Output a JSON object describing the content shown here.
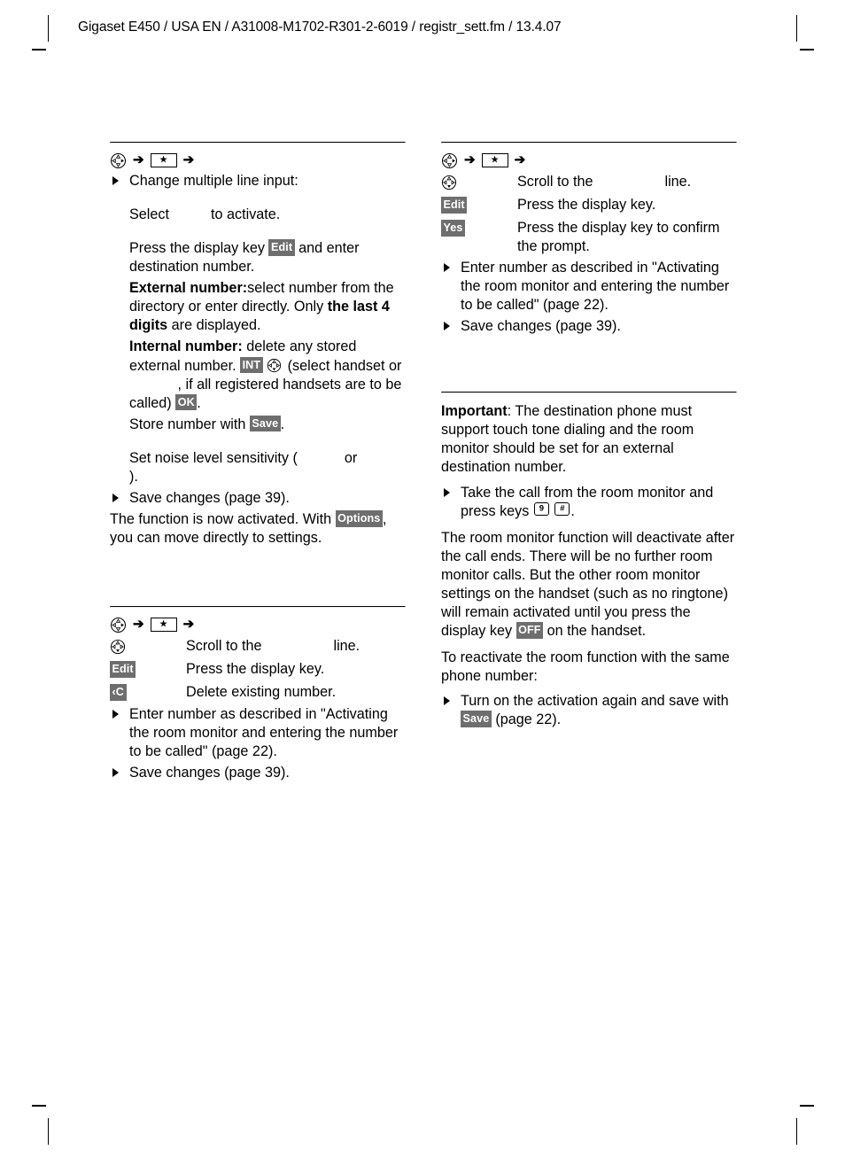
{
  "header": {
    "text": "Gigaset E450 / USA EN / A31008-M1702-R301-2-6019 / registr_sett.fm / 13.4.07"
  },
  "icons": {
    "nav": "navigation-key-icon",
    "arrow": "➔",
    "star_key": "star-key-icon",
    "key_9": "9",
    "key_hash": "#"
  },
  "softkeys": {
    "edit": "Edit",
    "save": "Save",
    "ok": "OK",
    "yes": "Yes",
    "off": "OFF",
    "int": "INT",
    "options": "Options",
    "delete": "‹C"
  },
  "left_column": {
    "section1": {
      "bullet1": "Change multiple line input:",
      "line_select_pre": "Select",
      "line_select_post": "to activate.",
      "press_key_pre": "Press the display key",
      "press_key_post": "and enter destination number.",
      "external_label": "External number:",
      "external_text_1": "select number from the directory or enter directly. Only ",
      "external_bold": "the last 4 digits",
      "external_text_2": " are displayed.",
      "internal_label": "Internal number:",
      "internal_text_1": "delete any stored external number.",
      "internal_text_2": "(select handset or",
      "internal_text_3": ", if all registered handsets are to be called)",
      "internal_text_4": ".",
      "store_pre": "Store number with",
      "store_post": ".",
      "noise_pre": "Set noise level sensitivity (",
      "noise_mid": "or",
      "noise_post": ").",
      "save_changes": "Save changes (page 39).",
      "activated_text_1": "The function is now activated. With",
      "activated_text_2": ", you can move directly to settings."
    },
    "section2": {
      "row1_desc_pre": "Scroll to the",
      "row1_desc_post": "line.",
      "row2_desc": "Press the display key.",
      "row3_desc": "Delete existing number.",
      "bullet_enter": "Enter number as described in \"Activating the room monitor and entering the number to be called\" (page 22).",
      "bullet_save": "Save changes (page 39)."
    }
  },
  "right_column": {
    "section1": {
      "row1_desc_pre": "Scroll to the",
      "row1_desc_post": "line.",
      "row2_desc": "Press the display key.",
      "row3_desc": "Press the display key to confirm the prompt.",
      "bullet_enter": "Enter number as described in \"Activating the room monitor and entering the number to be called\" (page 22).",
      "bullet_save": "Save changes (page 39)."
    },
    "section2": {
      "important_label": "Important",
      "important_text": ": The destination phone must support touch tone dialing and the room monitor should be set for an external destination number.",
      "bullet_take_call_pre": "Take the call from the room monitor and press keys",
      "bullet_take_call_post": ".",
      "deactivate_text_1": "The room monitor function will deactivate after the call ends. There will be no further room monitor calls. But the other room monitor settings on the handset (such as no ringtone) will remain activated until you press the display key",
      "deactivate_text_2": "on the handset.",
      "reactivate_text": "To reactivate the room function with the same phone number:",
      "bullet_turn_on_pre": "Turn on the activation again and save with",
      "bullet_turn_on_post": "(page 22)."
    }
  },
  "colors": {
    "softkey_background": "#6e6e6e",
    "softkey_text": "#ffffff",
    "rule": "#000000",
    "text": "#000000"
  }
}
